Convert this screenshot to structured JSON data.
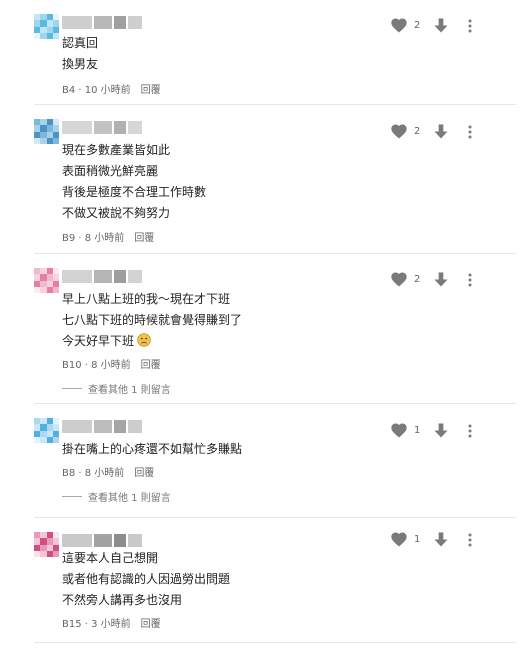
{
  "comments": [
    {
      "lines": [
        "認真回",
        "換男友"
      ],
      "floor": "B4 · 10 小時前",
      "reply_label": "回覆",
      "likes": "2",
      "more_replies": null,
      "avatar_colors": [
        "#bfe6f5",
        "#5bb8e0",
        "#9ed6ee",
        "#e6f4fb"
      ],
      "author_colors": [
        "#cfcfcf",
        "#b8b8b8",
        "#a0a0a0"
      ]
    },
    {
      "lines": [
        "現在多數產業皆如此",
        "表面稍微光鮮亮麗",
        "背後是極度不合理工作時數",
        "不做又被說不夠努力"
      ],
      "floor": "B9 · 8 小時前",
      "reply_label": "回覆",
      "likes": "2",
      "more_replies": null,
      "avatar_colors": [
        "#7fb7d8",
        "#4a93c2",
        "#a8d2ea",
        "#d5e9f5"
      ],
      "author_colors": [
        "#d6d6d6",
        "#c2c2c2",
        "#b0b0b0"
      ]
    },
    {
      "lines": [
        "早上八點上班的我～現在才下班",
        "七八點下班的時候就會覺得賺到了",
        "今天好早下班"
      ],
      "floor": "B10 · 8 小時前",
      "reply_label": "回覆",
      "likes": "2",
      "more_replies": "查看其他 1 則留言",
      "avatar_colors": [
        "#f2b8cc",
        "#e57fa3",
        "#f7d3df",
        "#fbeaf0"
      ],
      "author_colors": [
        "#d2d2d2",
        "#b5b5b5",
        "#9e9e9e"
      ]
    },
    {
      "lines": [
        "掛在嘴上的心疼還不如幫忙多賺點"
      ],
      "floor": "B8 · 8 小時前",
      "reply_label": "回覆",
      "likes": "1",
      "more_replies": "查看其他 1 則留言",
      "avatar_colors": [
        "#a9d8f2",
        "#54aedf",
        "#c9e7f7",
        "#e5f3fb"
      ],
      "author_colors": [
        "#cdcdcd",
        "#bcbcbc",
        "#a6a6a6"
      ]
    },
    {
      "lines": [
        "這要本人自己想開",
        "或者他有認識的人因過勞出問題",
        "不然旁人講再多也沒用"
      ],
      "floor": "B15 · 3 小時前",
      "reply_label": "回覆",
      "likes": "1",
      "more_replies": null,
      "avatar_colors": [
        "#e79ab8",
        "#cf4f82",
        "#f3c5d7",
        "#f9e3ec"
      ],
      "author_colors": [
        "#c9c9c9",
        "#a3a3a3",
        "#8d8d8d"
      ]
    }
  ],
  "icons": {
    "like": "heart-icon",
    "downvote": "arrow-down-icon",
    "more": "more-vertical-icon",
    "emoji": "sad-face-emoji-icon"
  },
  "colors": {
    "icon_gray": "#7a7a7a",
    "text": "#222222",
    "meta": "#666666",
    "divider": "#e6e6e6",
    "emoji": "#f3c54d"
  }
}
